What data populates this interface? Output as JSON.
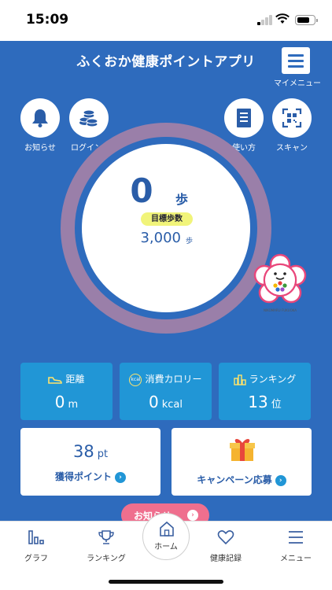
{
  "status_bar": {
    "time": "15:09",
    "battery_level": 0.75
  },
  "header": {
    "title": "ふくおか健康ポイントアプリ",
    "menu_label": "マイメニュー"
  },
  "top_buttons": {
    "notice": "お知らせ",
    "login": "ログインP",
    "howto": "使い方",
    "scan": "スキャン"
  },
  "steps": {
    "value": "0",
    "unit": "歩",
    "goal_badge": "目標歩数",
    "goal_value": "3,000",
    "goal_unit": "歩",
    "progress": 0
  },
  "stats": {
    "distance": {
      "label": "距離",
      "value": "0",
      "unit": "m"
    },
    "calories": {
      "label": "消費カロリー",
      "value": "0",
      "unit": "kcal",
      "icon_text": "kcal"
    },
    "ranking": {
      "label": "ランキング",
      "value": "13",
      "unit": "位"
    }
  },
  "points": {
    "value": "38",
    "unit": "pt",
    "link": "獲得ポイント"
  },
  "campaign": {
    "link": "キャンペーン応募"
  },
  "notice_pill": {
    "label": "お知らせ"
  },
  "mascot": {
    "caption": "NIKOMARU FUKUOKA"
  },
  "nav": {
    "graph": "グラフ",
    "ranking": "ランキング",
    "home": "ホーム",
    "health": "健康記録",
    "menu": "メニュー"
  },
  "colors": {
    "primary_blue": "#2e6bbd",
    "card_blue": "#2196d6",
    "ring_purple": "#9a7fa9",
    "goal_yellow": "#f1f47a",
    "notice_pink": "#ef6f8e"
  }
}
